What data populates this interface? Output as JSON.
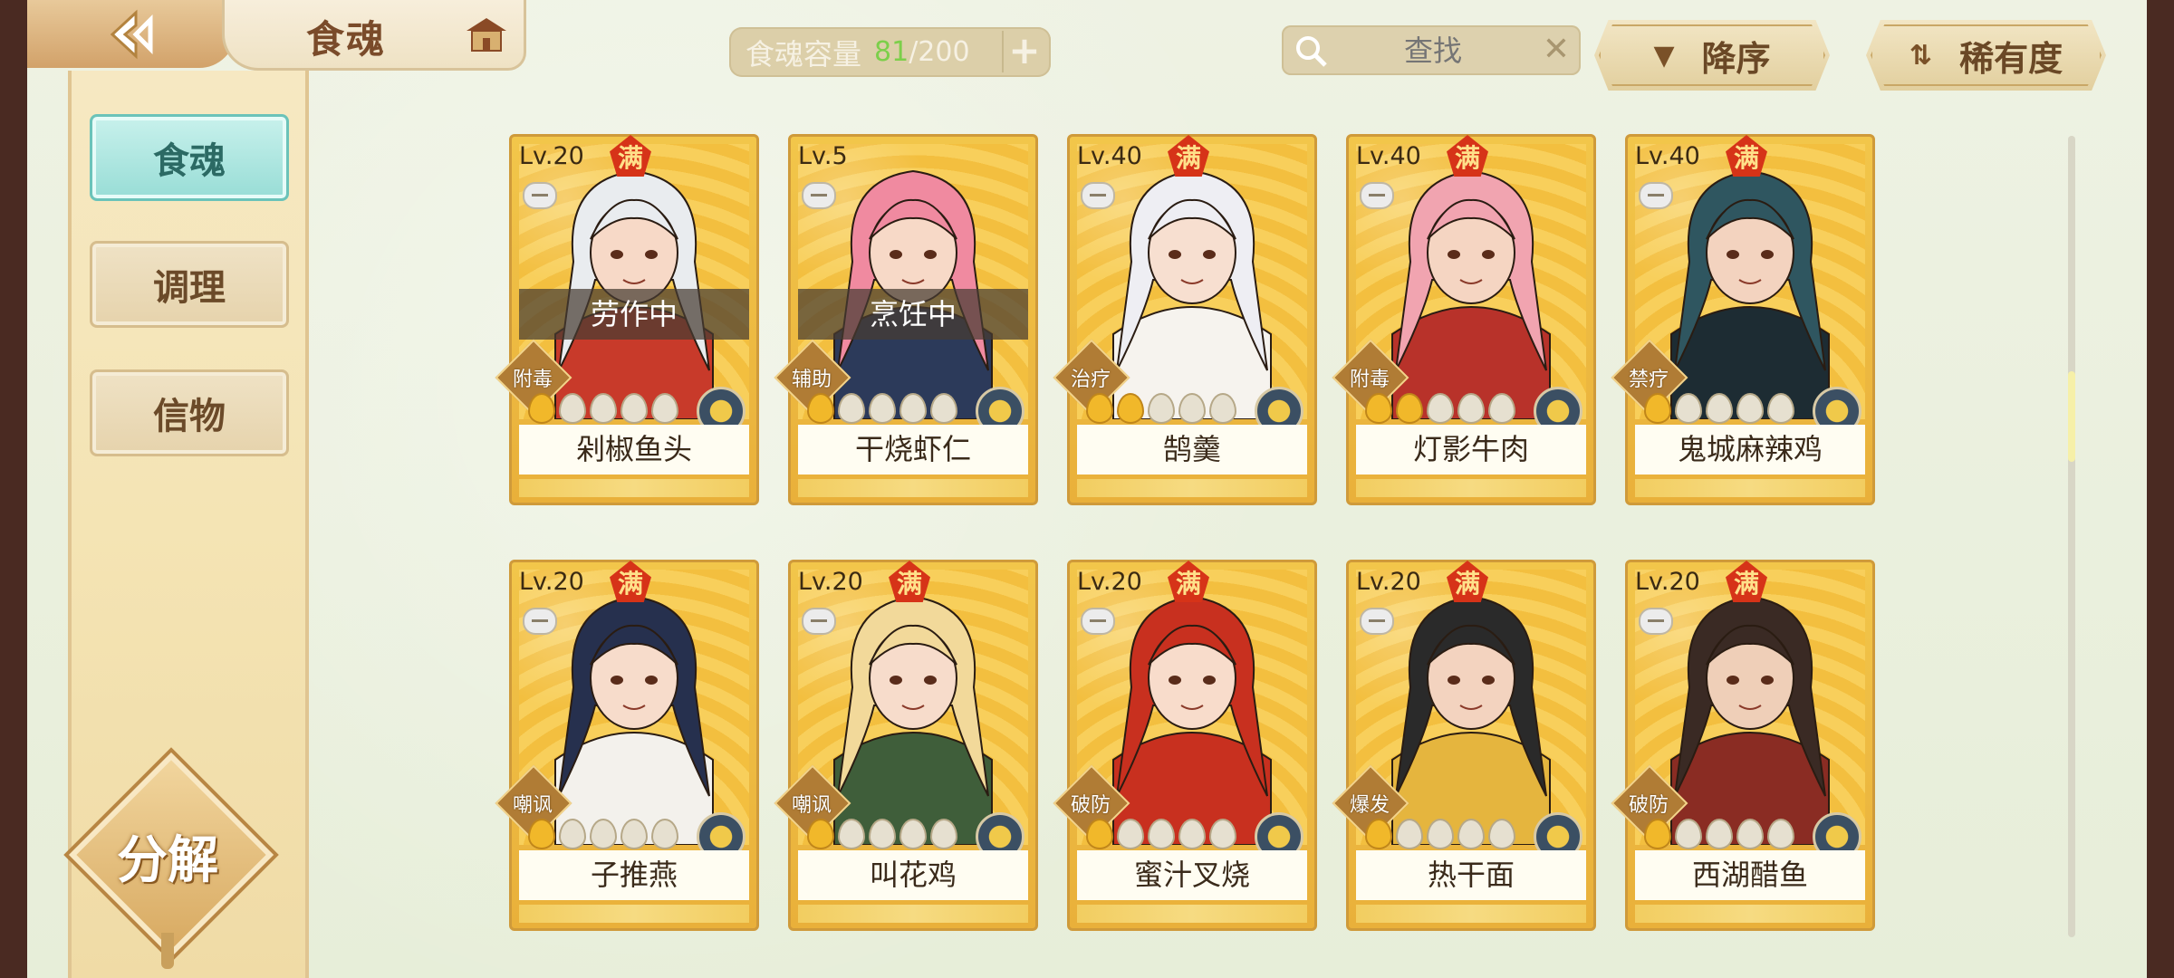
{
  "header": {
    "title": "食魂"
  },
  "capacity": {
    "label": "食魂容量",
    "used": "81",
    "max": "/200"
  },
  "search": {
    "placeholder": "查找"
  },
  "sort": {
    "label": "降序"
  },
  "rarity": {
    "label": "稀有度"
  },
  "sidebar": {
    "items": [
      {
        "label": "食魂",
        "active": true
      },
      {
        "label": "调理",
        "active": false
      },
      {
        "label": "信物",
        "active": false
      }
    ],
    "decompose_label": "分解"
  },
  "cards": [
    {
      "level": "Lv.20",
      "max": "满",
      "status": "劳作中",
      "role": "附毒",
      "hearts": 1,
      "name": "剁椒鱼头",
      "hair": "#e9ecef",
      "outfit": "#c83a2a",
      "skin": "#f7d9c7"
    },
    {
      "level": "Lv.5",
      "max": "",
      "status": "烹饪中",
      "role": "辅助",
      "hearts": 1,
      "name": "干烧虾仁",
      "hair": "#f08aa0",
      "outfit": "#2c3a5a",
      "skin": "#f7d9c7"
    },
    {
      "level": "Lv.40",
      "max": "满",
      "status": "",
      "role": "治疗",
      "hearts": 2,
      "name": "鹄羹",
      "hair": "#eeeef3",
      "outfit": "#f6f3ee",
      "skin": "#f7dfd0"
    },
    {
      "level": "Lv.40",
      "max": "满",
      "status": "",
      "role": "附毒",
      "hearts": 2,
      "name": "灯影牛肉",
      "hair": "#f1a4b0",
      "outfit": "#b8322a",
      "skin": "#f5d5c2"
    },
    {
      "level": "Lv.40",
      "max": "满",
      "status": "",
      "role": "禁疗",
      "hearts": 1,
      "name": "鬼城麻辣鸡",
      "hair": "#2f5660",
      "outfit": "#1d2c33",
      "skin": "#f3d3bf"
    },
    {
      "level": "Lv.20",
      "max": "满",
      "status": "",
      "role": "嘲讽",
      "hearts": 1,
      "name": "子推燕",
      "hair": "#26304e",
      "outfit": "#f3f1ec",
      "skin": "#f7dccb"
    },
    {
      "level": "Lv.20",
      "max": "满",
      "status": "",
      "role": "嘲讽",
      "hearts": 1,
      "name": "叫花鸡",
      "hair": "#f2d99a",
      "outfit": "#3f5e3a",
      "skin": "#f7dccb"
    },
    {
      "level": "Lv.20",
      "max": "满",
      "status": "",
      "role": "破防",
      "hearts": 1,
      "name": "蜜汁叉烧",
      "hair": "#c8301f",
      "outfit": "#c8301f",
      "skin": "#f8dccb"
    },
    {
      "level": "Lv.20",
      "max": "满",
      "status": "",
      "role": "爆发",
      "hearts": 1,
      "name": "热干面",
      "hair": "#2a2a2a",
      "outfit": "#e5b53e",
      "skin": "#f3d3bf"
    },
    {
      "level": "Lv.20",
      "max": "满",
      "status": "",
      "role": "破防",
      "hearts": 1,
      "name": "西湖醋鱼",
      "hair": "#3a2a24",
      "outfit": "#8a2c23",
      "skin": "#efcfb8"
    }
  ]
}
